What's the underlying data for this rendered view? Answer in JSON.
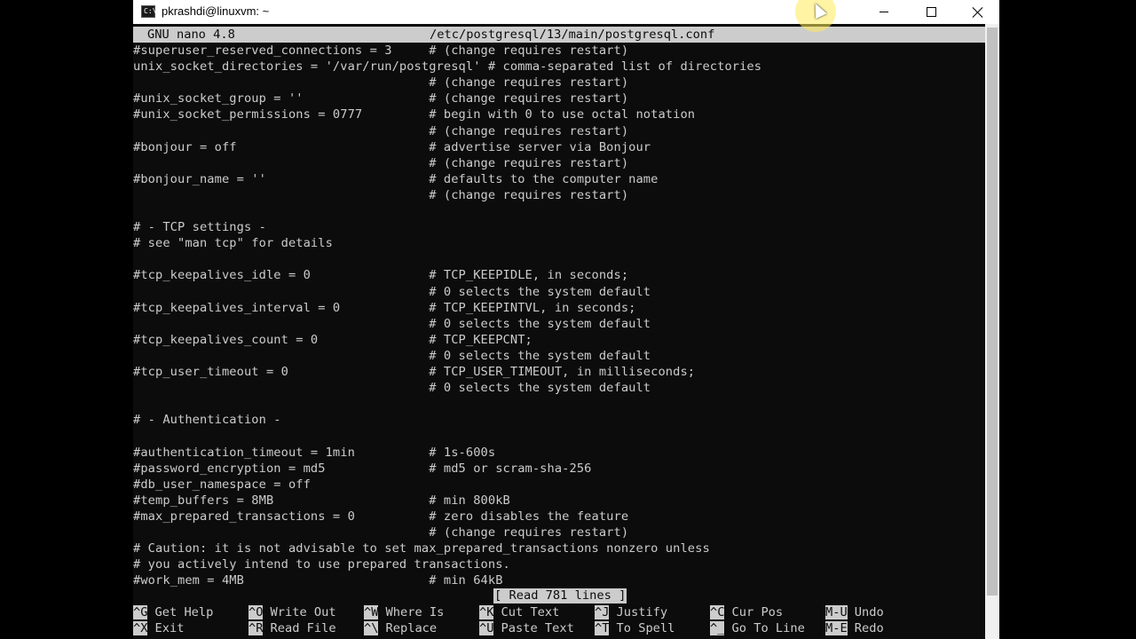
{
  "window": {
    "title": "pkrashdi@linuxvm: ~",
    "app_icon_text": "C:\\"
  },
  "nano": {
    "version": "GNU nano 4.8",
    "file_path": "/etc/postgresql/13/main/postgresql.conf",
    "status": "[ Read 781 lines ]"
  },
  "lines": [
    "#superuser_reserved_connections = 3     # (change requires restart)",
    "unix_socket_directories = '/var/run/postgresql' # comma-separated list of directories",
    "                                        # (change requires restart)",
    "#unix_socket_group = ''                 # (change requires restart)",
    "#unix_socket_permissions = 0777         # begin with 0 to use octal notation",
    "                                        # (change requires restart)",
    "#bonjour = off                          # advertise server via Bonjour",
    "                                        # (change requires restart)",
    "#bonjour_name = ''                      # defaults to the computer name",
    "                                        # (change requires restart)",
    "",
    "# - TCP settings -",
    "# see \"man tcp\" for details",
    "",
    "#tcp_keepalives_idle = 0                # TCP_KEEPIDLE, in seconds;",
    "                                        # 0 selects the system default",
    "#tcp_keepalives_interval = 0            # TCP_KEEPINTVL, in seconds;",
    "                                        # 0 selects the system default",
    "#tcp_keepalives_count = 0               # TCP_KEEPCNT;",
    "                                        # 0 selects the system default",
    "#tcp_user_timeout = 0                   # TCP_USER_TIMEOUT, in milliseconds;",
    "                                        # 0 selects the system default",
    "",
    "# - Authentication -",
    "",
    "#authentication_timeout = 1min          # 1s-600s",
    "#password_encryption = md5              # md5 or scram-sha-256",
    "#db_user_namespace = off",
    "#temp_buffers = 8MB                     # min 800kB",
    "#max_prepared_transactions = 0          # zero disables the feature",
    "                                        # (change requires restart)",
    "# Caution: it is not advisable to set max_prepared_transactions nonzero unless",
    "# you actively intend to use prepared transactions.",
    "#work_mem = 4MB                         # min 64kB"
  ],
  "shortcuts": [
    {
      "key": "^G",
      "label": "Get Help"
    },
    {
      "key": "^X",
      "label": "Exit"
    },
    {
      "key": "^O",
      "label": "Write Out"
    },
    {
      "key": "^R",
      "label": "Read File"
    },
    {
      "key": "^W",
      "label": "Where Is"
    },
    {
      "key": "^\\",
      "label": "Replace"
    },
    {
      "key": "^K",
      "label": "Cut Text"
    },
    {
      "key": "^U",
      "label": "Paste Text"
    },
    {
      "key": "^J",
      "label": "Justify"
    },
    {
      "key": "^T",
      "label": "To Spell"
    },
    {
      "key": "^C",
      "label": "Cur Pos"
    },
    {
      "key": "^_",
      "label": "Go To Line"
    },
    {
      "key": "M-U",
      "label": "Undo"
    },
    {
      "key": "M-E",
      "label": "Redo"
    }
  ]
}
